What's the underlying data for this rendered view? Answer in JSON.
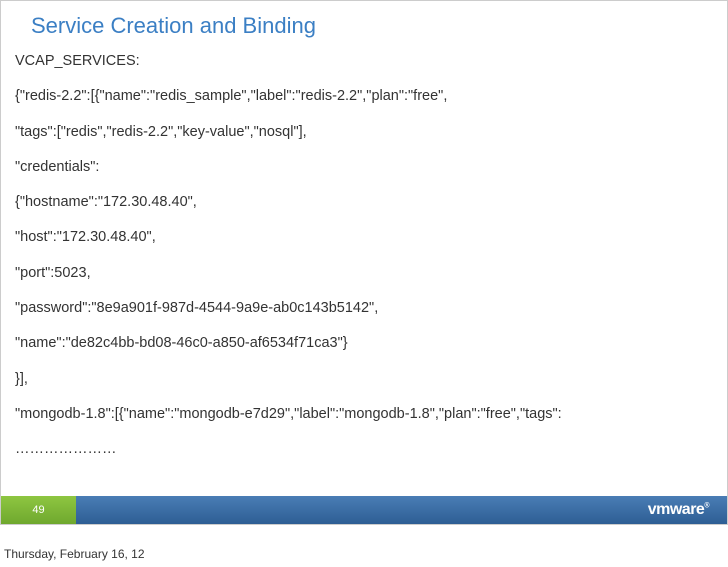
{
  "slide": {
    "title": "Service Creation and Binding",
    "lines": [
      "VCAP_SERVICES:",
      "{\"redis-2.2\":[{\"name\":\"redis_sample\",\"label\":\"redis-2.2\",\"plan\":\"free\",",
      "\"tags\":[\"redis\",\"redis-2.2\",\"key-value\",\"nosql\"],",
      "\"credentials\":",
      "{\"hostname\":\"172.30.48.40\",",
      "\"host\":\"172.30.48.40\",",
      "\"port\":5023,",
      "\"password\":\"8e9a901f-987d-4544-9a9e-ab0c143b5142\",",
      "\"name\":\"de82c4bb-bd08-46c0-a850-af6534f71ca3\"}",
      "}],",
      "\"mongodb-1.8\":[{\"name\":\"mongodb-e7d29\",\"label\":\"mongodb-1.8\",\"plan\":\"free\",\"tags\":",
      "…………………"
    ],
    "page_number": "49",
    "logo_text": "vmware",
    "logo_mark": "®"
  },
  "date": "Thursday, February 16, 12"
}
